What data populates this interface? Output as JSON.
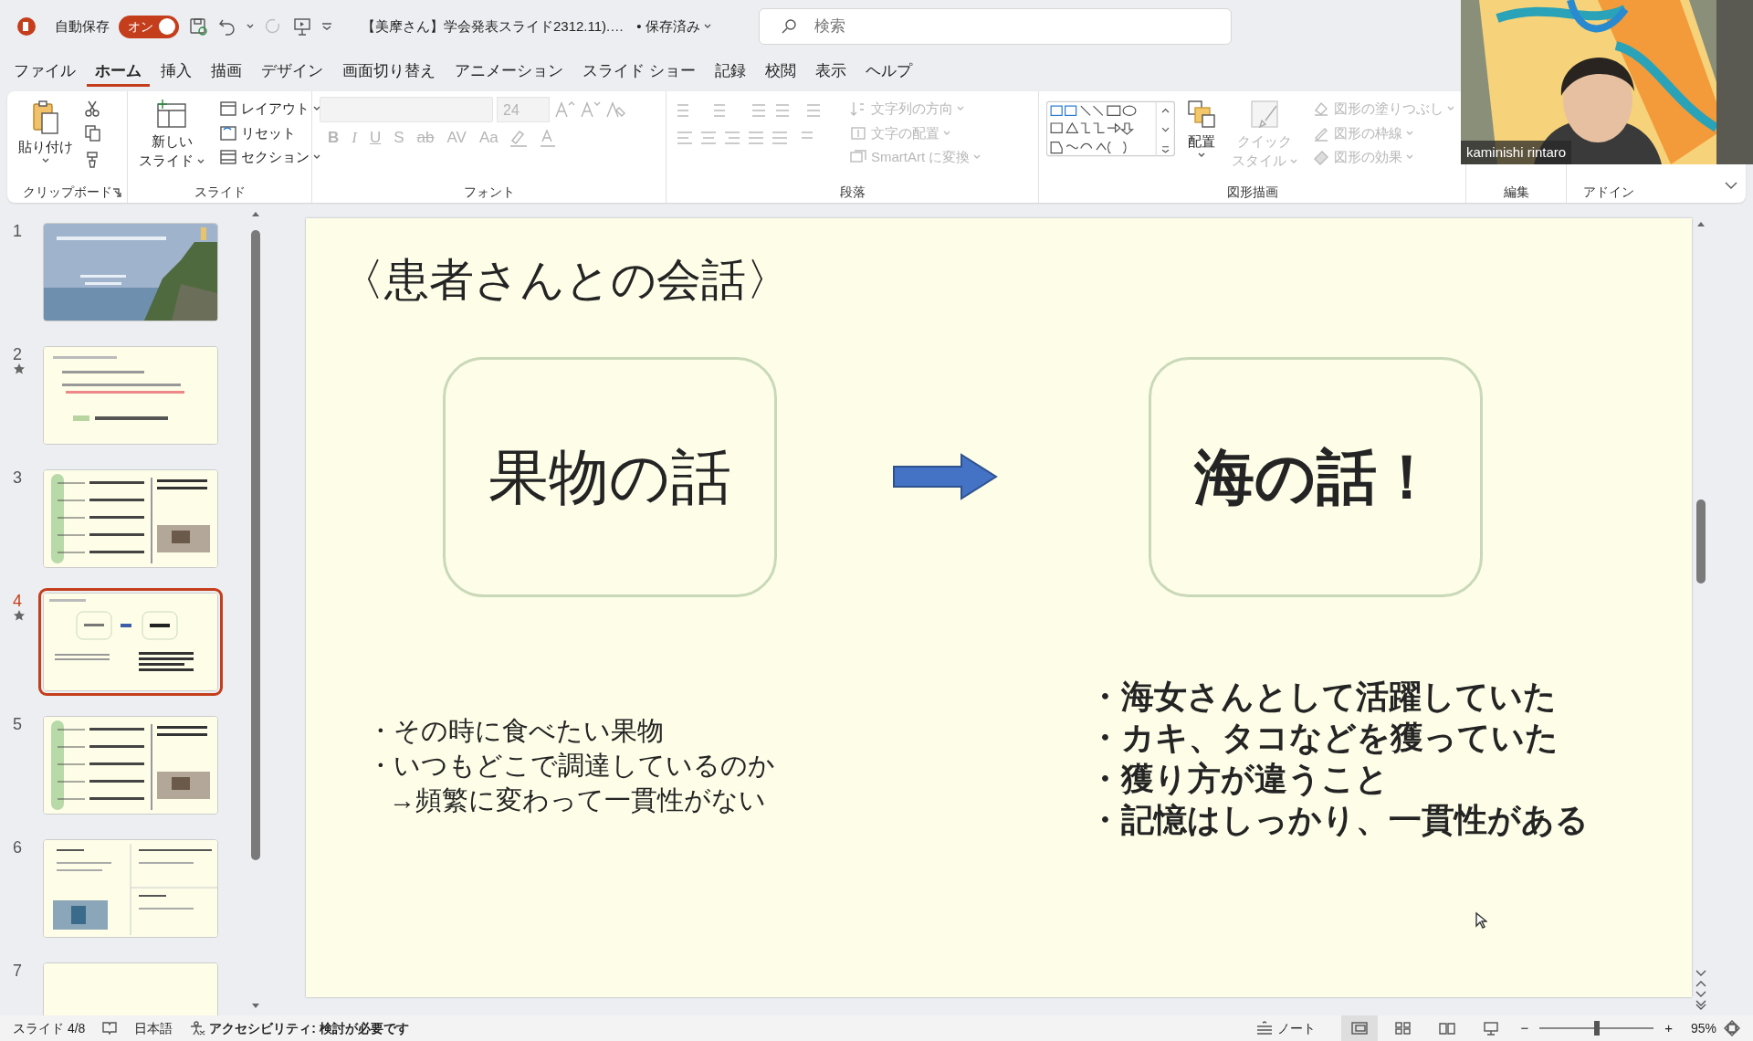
{
  "title_bar": {
    "autosave_label": "自動保存",
    "autosave_on": true,
    "autosave_state": "オン",
    "document_title": "【美摩さん】学会発表スライド2312.11).…",
    "save_status": "• 保存済み",
    "search_placeholder": "検索"
  },
  "ribbon_tabs": [
    {
      "label": "ファイル",
      "selected": false
    },
    {
      "label": "ホーム",
      "selected": true
    },
    {
      "label": "挿入",
      "selected": false
    },
    {
      "label": "描画",
      "selected": false
    },
    {
      "label": "デザイン",
      "selected": false
    },
    {
      "label": "画面切り替え",
      "selected": false
    },
    {
      "label": "アニメーション",
      "selected": false
    },
    {
      "label": "スライド ショー",
      "selected": false
    },
    {
      "label": "記録",
      "selected": false
    },
    {
      "label": "校閲",
      "selected": false
    },
    {
      "label": "表示",
      "selected": false
    },
    {
      "label": "ヘルプ",
      "selected": false
    }
  ],
  "ribbon": {
    "clipboard": {
      "label": "クリップボード",
      "paste": "貼り付け"
    },
    "slides": {
      "label": "スライド",
      "new_slide": [
        "新しい",
        "スライド"
      ],
      "items": [
        {
          "label": "レイアウト",
          "disabled": false
        },
        {
          "label": "リセット",
          "disabled": false
        },
        {
          "label": "セクション",
          "disabled": false
        }
      ]
    },
    "font": {
      "label": "フォント",
      "size": "24",
      "format_buttons": [
        "B",
        "I",
        "U",
        "S",
        "ab",
        "AV",
        "Aa"
      ],
      "disabled": true
    },
    "paragraph": {
      "label": "段落",
      "items": [
        {
          "label": "文字列の方向",
          "disabled": true
        },
        {
          "label": "文字の配置",
          "disabled": true
        },
        {
          "label": "SmartArt に変換",
          "disabled": true
        }
      ]
    },
    "drawing": {
      "label": "図形描画",
      "arrange": "配置",
      "quick_style": [
        "クイック",
        "スタイル"
      ],
      "items": [
        {
          "label": "図形の塗りつぶし",
          "disabled": true
        },
        {
          "label": "図形の枠線",
          "disabled": true
        },
        {
          "label": "図形の効果",
          "disabled": true
        }
      ]
    },
    "editing": {
      "label": "編集"
    },
    "addins": {
      "label": "アドイン"
    }
  },
  "webcam": {
    "name": "kaminishi rintaro"
  },
  "slide_thumbnails": [
    {
      "number": "1",
      "starred": false,
      "selected": false
    },
    {
      "number": "2",
      "kind": "bullets",
      "starred": true,
      "selected": false
    },
    {
      "number": "3",
      "kind": "timeline",
      "starred": false,
      "selected": false
    },
    {
      "number": "4",
      "kind": "compare",
      "starred": true,
      "selected": true
    },
    {
      "number": "5",
      "kind": "timeline",
      "starred": false,
      "selected": false
    },
    {
      "number": "6",
      "kind": "panels",
      "starred": false,
      "selected": false
    },
    {
      "number": "7",
      "kind": "blank",
      "starred": false,
      "selected": false
    }
  ],
  "slide": {
    "title": "〈患者さんとの会話〉",
    "boxes": [
      {
        "text": "果物の話",
        "bold": false
      },
      {
        "text": "海の話！",
        "bold": true
      }
    ],
    "left_notes": [
      {
        "text": "・その時に食べたい果物",
        "kind": "bullet"
      },
      {
        "text": "・いつもどこで調達しているのか",
        "kind": "bullet"
      },
      {
        "text": "→頻繁に変わって一貫性がない",
        "kind": "continuation"
      }
    ],
    "right_notes": [
      {
        "text": "・海女さんとして活躍していた",
        "kind": "bullet"
      },
      {
        "text": "・カキ、タコなどを獲っていた",
        "kind": "bullet"
      },
      {
        "text": "・獲り方が違うこと",
        "kind": "bullet"
      },
      {
        "text": "・記憶はしっかり、一貫性がある",
        "kind": "bullet"
      }
    ]
  },
  "status_bar": {
    "slide_counter": "スライド 4/8",
    "language": "日本語",
    "accessibility": "アクセシビリティ: 検討が必要です",
    "notes": "ノート",
    "views": [
      {
        "kind": "normal",
        "selected": true
      },
      {
        "kind": "sorter",
        "selected": false
      },
      {
        "kind": "reading",
        "selected": false
      },
      {
        "kind": "slideshow",
        "selected": false
      }
    ],
    "zoom_out": "−",
    "zoom_in": "+",
    "zoom": {
      "level": 0.48
    },
    "zoom_label": "95%"
  }
}
